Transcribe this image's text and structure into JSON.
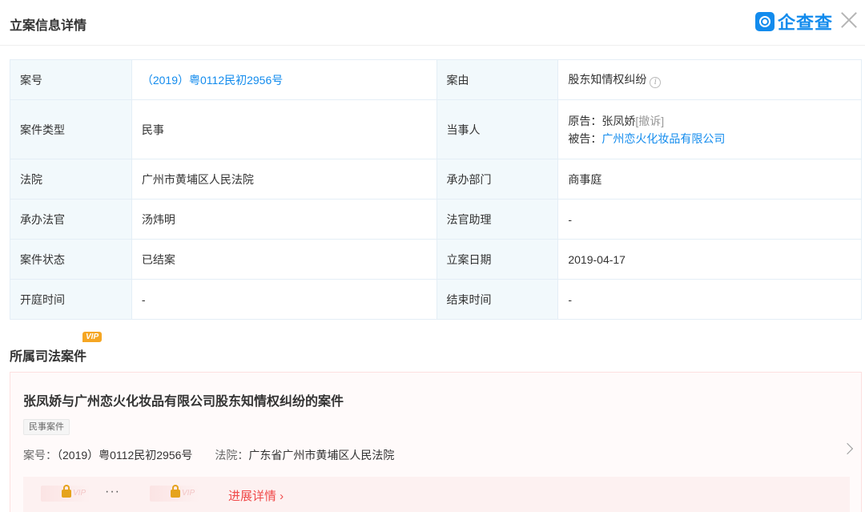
{
  "header": {
    "title": "立案信息详情",
    "brand": "企查查"
  },
  "info_table": {
    "case_no_label": "案号",
    "case_no": "（2019）粤0112民初2956号",
    "cause_label": "案由",
    "cause": "股东知情权纠纷",
    "case_type_label": "案件类型",
    "case_type": "民事",
    "party_label": "当事人",
    "plaintiff_prefix": "原告：",
    "plaintiff": "张凤娇",
    "plaintiff_tag": "[撤诉]",
    "defendant_prefix": "被告：",
    "defendant": "广州恋火化妆品有限公司",
    "court_label": "法院",
    "court": "广州市黄埔区人民法院",
    "department_label": "承办部门",
    "department": "商事庭",
    "judge_label": "承办法官",
    "judge": "汤炜明",
    "assistant_label": "法官助理",
    "assistant": "-",
    "status_label": "案件状态",
    "status": "已结案",
    "filing_date_label": "立案日期",
    "filing_date": "2019-04-17",
    "hearing_time_label": "开庭时间",
    "hearing_time": "-",
    "end_time_label": "结束时间",
    "end_time": "-"
  },
  "related": {
    "section_title": "所属司法案件",
    "vip_badge": "VIP",
    "card": {
      "title": "张凤娇与广州恋火化妆品有限公司股东知情权纠纷的案件",
      "type_tag": "民事案件",
      "case_no_key": "案号：",
      "case_no": "（2019）粤0112民初2956号",
      "court_key": "法院：",
      "court": "广东省广州市黄埔区人民法院",
      "dots": "···",
      "lock_vip": "VIP",
      "progress_link": "进展详情 ›"
    }
  },
  "colors": {
    "accent": "#128bed",
    "label_bg": "#f2f9fc",
    "danger": "#f04a4a",
    "vip": "#f5a623"
  }
}
